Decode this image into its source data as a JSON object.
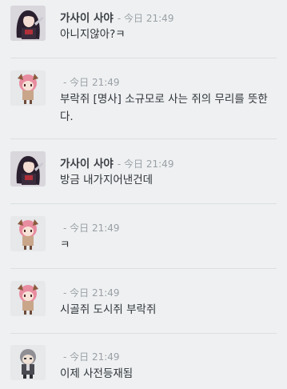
{
  "messages": [
    {
      "author": "가사이 사야",
      "timestamp": "- 今日 21:49",
      "text": "아니지않아?ㅋ",
      "avatar": "dark-haired-girl-avatar"
    },
    {
      "author": "",
      "timestamp": "- 今日 21:49",
      "text": "부락쥐 [명사] 소규모로 사는 쥐의 무리를 뜻한다.",
      "avatar": "pink-haired-chibi-avatar"
    },
    {
      "author": "가사이 사야",
      "timestamp": "- 今日 21:49",
      "text": "방금 내가지어낸건데",
      "avatar": "dark-haired-girl-avatar"
    },
    {
      "author": "",
      "timestamp": "- 今日 21:49",
      "text": "ㅋ",
      "avatar": "pink-haired-chibi-avatar"
    },
    {
      "author": "",
      "timestamp": "- 今日 21:49",
      "text": "시골쥐 도시쥐 부락쥐",
      "avatar": "pink-haired-chibi-avatar"
    },
    {
      "author": "",
      "timestamp": "- 今日 21:49",
      "text": "이제 사전등재됨",
      "avatar": "grey-haired-chibi-avatar"
    }
  ]
}
